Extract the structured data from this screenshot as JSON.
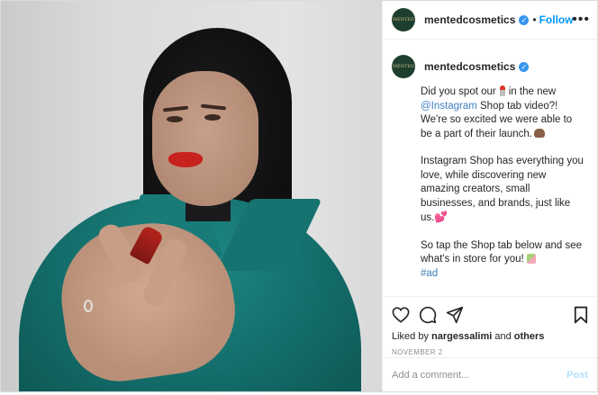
{
  "header": {
    "username": "mentedcosmetics",
    "separator": "•",
    "follow_label": "Follow",
    "more_icon": "more-horizontal-icon",
    "avatar_text": "MENTED"
  },
  "caption": {
    "username": "mentedcosmetics",
    "p1_a": "Did you spot our",
    "p1_b": "in the new",
    "mention": "@Instagram",
    "p1_c": "Shop tab video?! We're so excited we were able to be a part of their launch.",
    "p2": "Instagram Shop has everything you love, while discovering new amazing creators, small businesses, and brands, just like us.",
    "p3": "So tap the Shop tab below and see what's in store for you!",
    "hashtag": "#ad"
  },
  "actions": {
    "like_icon": "heart-icon",
    "comment_icon": "comment-icon",
    "share_icon": "share-icon",
    "save_icon": "bookmark-icon",
    "liked_by_prefix": "Liked by",
    "liked_by_user": "nargessalimi",
    "liked_by_and": "and",
    "liked_by_others": "others",
    "date": "NOVEMBER 2"
  },
  "comment": {
    "placeholder": "Add a comment...",
    "post_label": "Post"
  },
  "colors": {
    "accent": "#0095f6",
    "link": "#3f7fbf",
    "muted": "#8e8e8e",
    "post_disabled": "#b2dffc",
    "verified": "#3897f0"
  }
}
